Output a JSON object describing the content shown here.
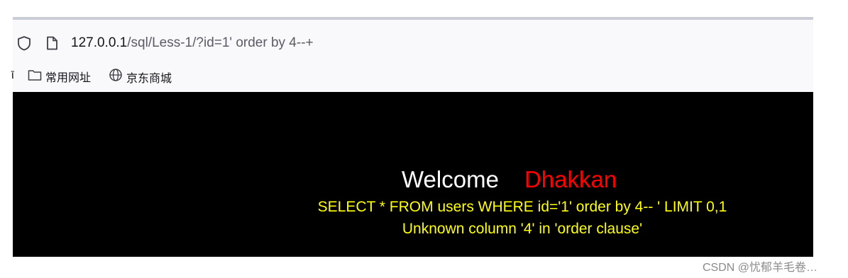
{
  "browser": {
    "url": {
      "host": "127.0.0.1",
      "path": "/sql/Less-1/?id=1' order by 4--+"
    },
    "bookmarks": [
      {
        "label": "常用网址",
        "icon": "folder-icon"
      },
      {
        "label": "京东商城",
        "icon": "globe-icon"
      }
    ],
    "bookmark_edge_glyph": "ῑ"
  },
  "page": {
    "welcome_text": "Welcome",
    "user_name": "Dhakkan",
    "query_text": "SELECT * FROM users WHERE id='1' order by 4-- ' LIMIT 0,1",
    "error_text": "Unknown column '4' in 'order clause'"
  },
  "colors": {
    "page_background": "#000000",
    "welcome": "#ffffff",
    "user_name": "#ff0000",
    "sql_text": "#ffff00"
  },
  "watermark": "CSDN @忧郁羊毛卷…"
}
